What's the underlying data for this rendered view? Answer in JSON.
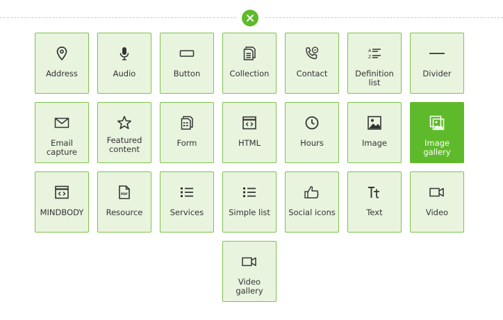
{
  "accent_color": "#5fba2b",
  "close_icon": "close-icon",
  "tiles": [
    {
      "label": "Address",
      "icon": "map-pin-icon"
    },
    {
      "label": "Audio",
      "icon": "microphone-icon"
    },
    {
      "label": "Button",
      "icon": "button-icon"
    },
    {
      "label": "Collection",
      "icon": "collection-icon"
    },
    {
      "label": "Contact",
      "icon": "phone-chat-icon"
    },
    {
      "label": "Definition list",
      "icon": "definition-list-icon"
    },
    {
      "label": "Divider",
      "icon": "divider-icon"
    },
    {
      "label": "Email capture",
      "icon": "envelope-icon"
    },
    {
      "label": "Featured content",
      "icon": "star-icon"
    },
    {
      "label": "Form",
      "icon": "form-icon"
    },
    {
      "label": "HTML",
      "icon": "code-window-icon"
    },
    {
      "label": "Hours",
      "icon": "clock-icon"
    },
    {
      "label": "Image",
      "icon": "image-icon"
    },
    {
      "label": "Image gallery",
      "icon": "image-gallery-icon",
      "selected": true
    },
    {
      "label": "MINDBODY",
      "icon": "code-window-icon"
    },
    {
      "label": "Resource",
      "icon": "pdf-file-icon"
    },
    {
      "label": "Services",
      "icon": "bullet-list-icon"
    },
    {
      "label": "Simple list",
      "icon": "bullet-list-icon"
    },
    {
      "label": "Social icons",
      "icon": "thumbs-up-icon"
    },
    {
      "label": "Text",
      "icon": "text-icon"
    },
    {
      "label": "Video",
      "icon": "video-camera-icon"
    },
    {
      "label": "Video gallery",
      "icon": "video-camera-icon"
    }
  ]
}
